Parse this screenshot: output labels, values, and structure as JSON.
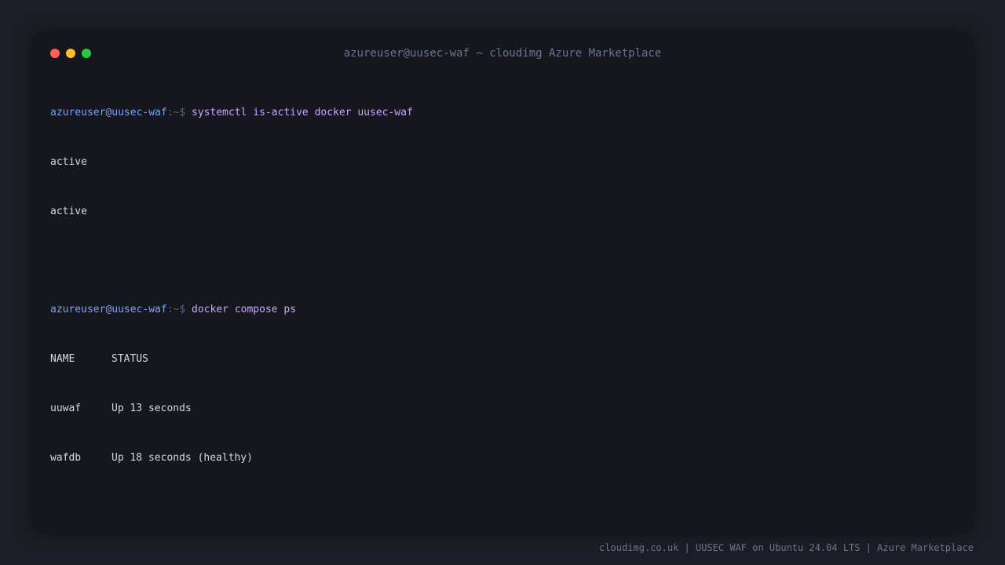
{
  "window": {
    "title": "azureuser@uusec-waf ~ cloudimg Azure Marketplace",
    "controls": {
      "close_color": "#ff5f57",
      "minimize_color": "#febc2e",
      "maximize_color": "#28c840"
    }
  },
  "terminal": {
    "prompt": {
      "user_host": "azureuser@uusec-waf",
      "suffix": ":~$"
    },
    "commands": [
      {
        "command": "systemctl is-active docker uusec-waf",
        "output": [
          "active",
          "active"
        ]
      },
      {
        "command": "docker compose ps",
        "table": {
          "headers": [
            "NAME",
            "STATUS"
          ],
          "rows": [
            [
              "uuwaf",
              "Up 13 seconds"
            ],
            [
              "wafdb",
              "Up 18 seconds (healthy)"
            ]
          ]
        }
      }
    ]
  },
  "footer": {
    "text": "cloudimg.co.uk | UUSEC WAF on Ubuntu 24.04 LTS | Azure Marketplace"
  },
  "colors": {
    "background": "#1c1d26",
    "window_bg": "#16171e",
    "prompt_user": "#7aa2f7",
    "command": "#c6a6ff",
    "output_text": "#d4d6e0",
    "muted_text": "#6b7394"
  }
}
